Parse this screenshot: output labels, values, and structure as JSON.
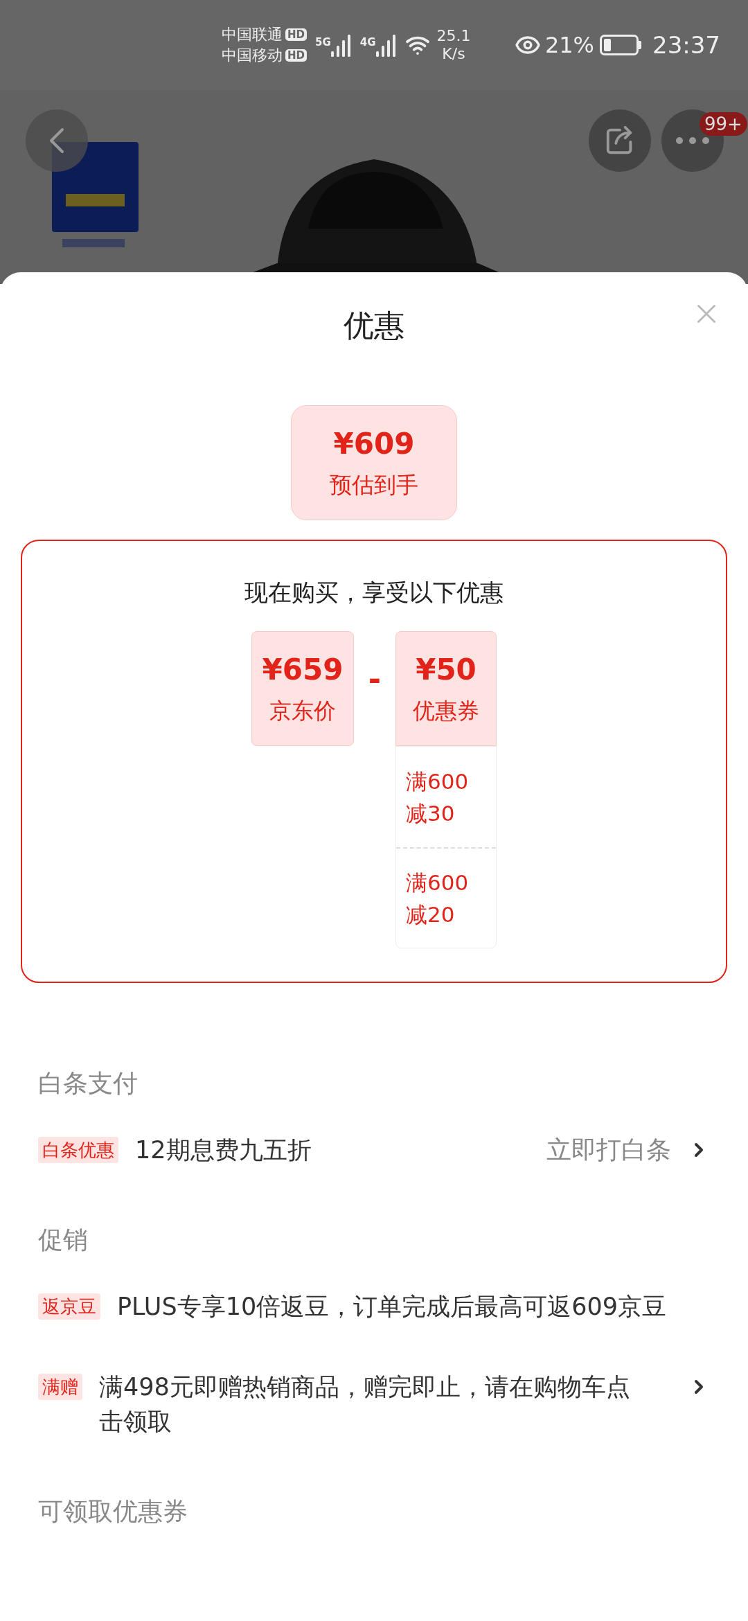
{
  "status_bar": {
    "carriers": [
      {
        "name": "中国联通",
        "badge": "HD"
      },
      {
        "name": "中国移动",
        "badge": "HD"
      }
    ],
    "networks": [
      "5G",
      "4G"
    ],
    "speed": "25.1",
    "speed_unit": "K/s",
    "battery": "21%",
    "time": "23:37"
  },
  "top_bar": {
    "more_badge": "99+"
  },
  "sheet": {
    "title": "优惠",
    "estimate": {
      "price": "¥609",
      "label": "预估到手"
    },
    "breakdown": {
      "heading": "现在购买，享受以下优惠",
      "base": {
        "price": "¥659",
        "label": "京东价"
      },
      "operator": "-",
      "discount": {
        "price": "¥50",
        "label": "优惠券",
        "rules": [
          "满600减30",
          "满600减20"
        ]
      }
    },
    "sections": [
      {
        "title": "白条支付",
        "items": [
          {
            "tag": "白条优惠",
            "text": "12期息费九五折",
            "action": "立即打白条",
            "arrow": true
          }
        ]
      },
      {
        "title": "促销",
        "items": [
          {
            "tag": "返京豆",
            "text": "PLUS专享10倍返豆，订单完成后最高可返609京豆",
            "arrow": false
          },
          {
            "tag": "满赠",
            "text": "满498元即赠热销商品，赠完即止，请在购物车点击领取",
            "arrow": true
          }
        ]
      },
      {
        "title": "可领取优惠券"
      }
    ]
  }
}
